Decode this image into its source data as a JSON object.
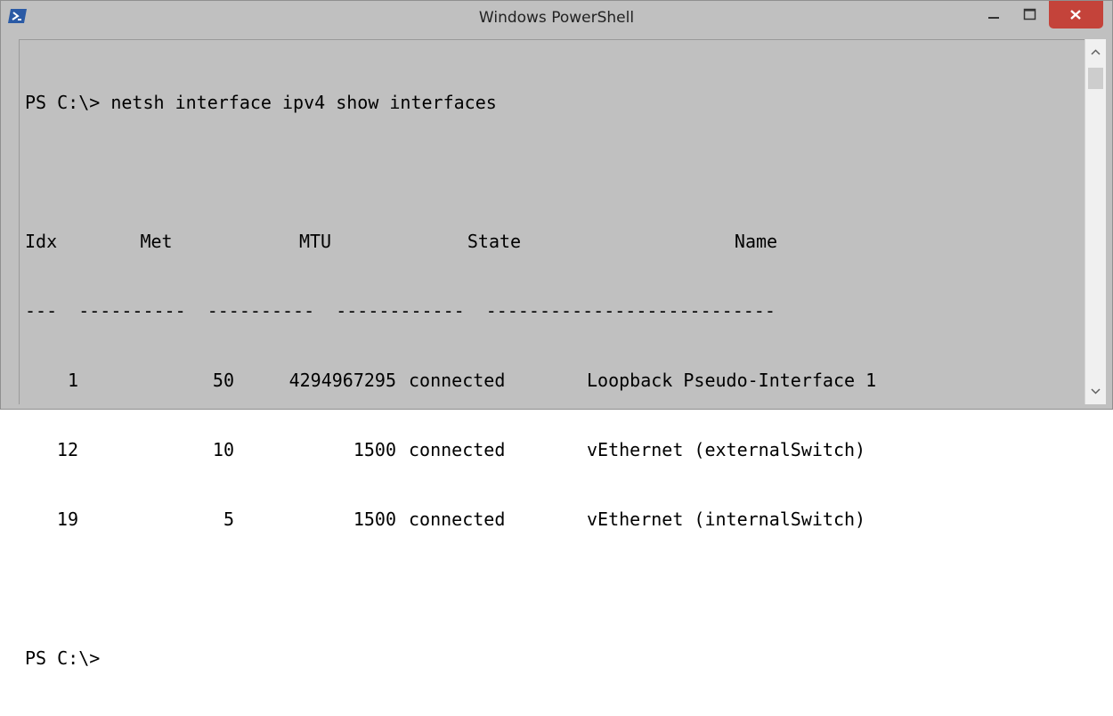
{
  "window": {
    "title": "Windows PowerShell",
    "icon": "powershell-icon",
    "controls": [
      "minimize-icon",
      "maximize-icon",
      "close-icon"
    ],
    "close_color": "#c4433a"
  },
  "console": {
    "background": "#c0c0c0",
    "command_line": "PS C:\\> netsh interface ipv4 show interfaces",
    "headers": {
      "idx": "Idx",
      "met": "Met",
      "mtu": "MTU",
      "state": "State",
      "name": "Name"
    },
    "separator": "---  ----------  ----------  ------------  ---------------------------",
    "rows": [
      {
        "idx": "1",
        "met": "50",
        "mtu": "4294967295",
        "state": "connected",
        "name": "Loopback Pseudo-Interface 1"
      },
      {
        "idx": "12",
        "met": "10",
        "mtu": "1500",
        "state": "connected",
        "name": "vEthernet (externalSwitch)"
      },
      {
        "idx": "19",
        "met": "5",
        "mtu": "1500",
        "state": "connected",
        "name": "vEthernet (internalSwitch)"
      }
    ],
    "prompt": "PS C:\\>"
  },
  "scrollbar": {
    "up_icon": "chevron-up-icon",
    "down_icon": "chevron-down-icon"
  }
}
